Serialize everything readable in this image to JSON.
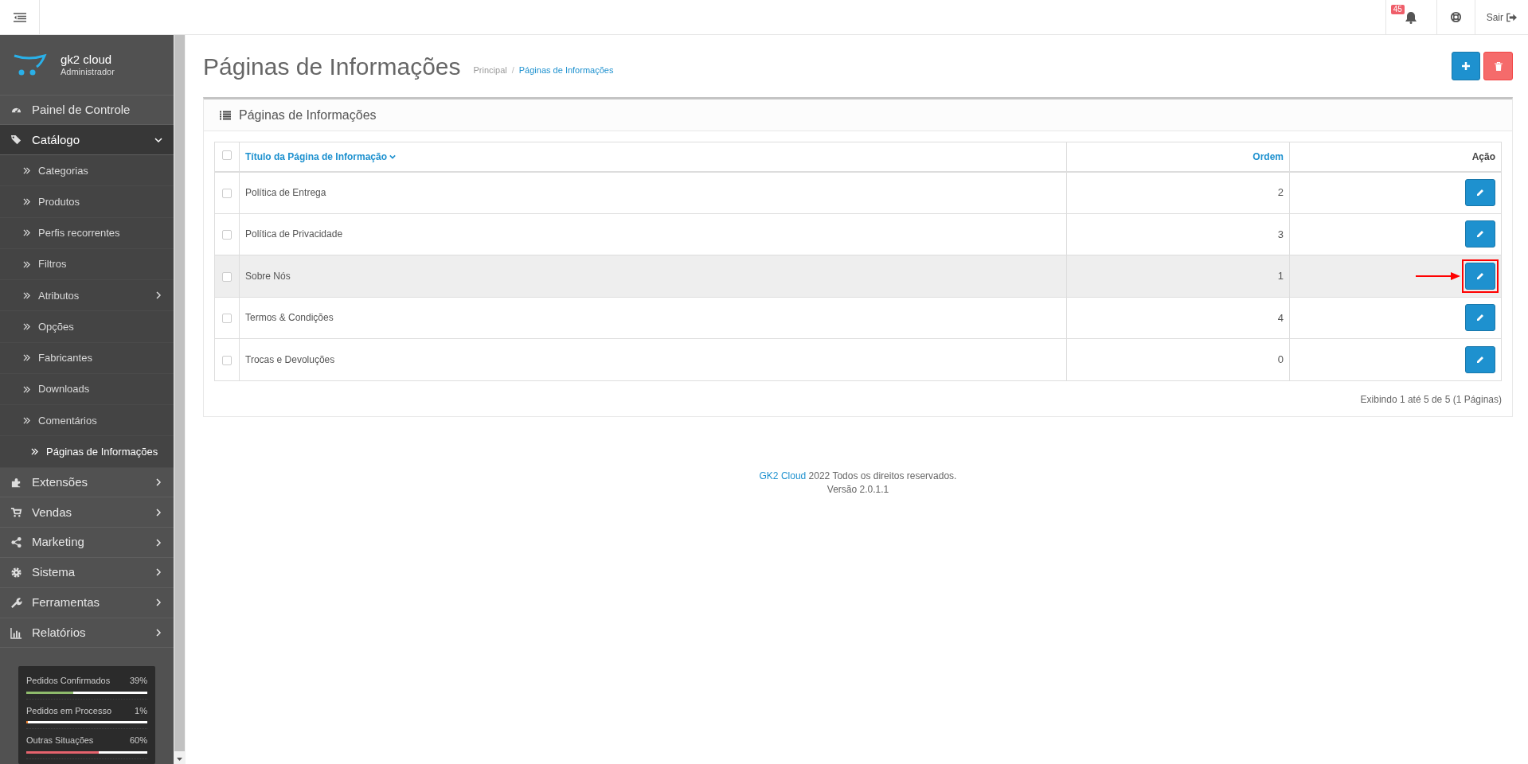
{
  "header": {
    "notifications": {
      "count": "45"
    },
    "logout": "Sair"
  },
  "sidebar": {
    "profile": {
      "name": "gk2 cloud",
      "role": "Administrador"
    },
    "items": [
      {
        "label": "Painel de Controle",
        "kind": "dashboard",
        "selected": false,
        "has_children": false,
        "expanded": false
      },
      {
        "label": "Catálogo",
        "kind": "tags",
        "selected": true,
        "has_children": true,
        "expanded": true,
        "children": [
          {
            "label": "Categorias",
            "selected": false,
            "has_children": false
          },
          {
            "label": "Produtos",
            "selected": false,
            "has_children": false
          },
          {
            "label": "Perfis recorrentes",
            "selected": false,
            "has_children": false
          },
          {
            "label": "Filtros",
            "selected": false,
            "has_children": false
          },
          {
            "label": "Atributos",
            "selected": false,
            "has_children": true
          },
          {
            "label": "Opções",
            "selected": false,
            "has_children": false
          },
          {
            "label": "Fabricantes",
            "selected": false,
            "has_children": false
          },
          {
            "label": "Downloads",
            "selected": false,
            "has_children": false
          },
          {
            "label": "Comentários",
            "selected": false,
            "has_children": false
          },
          {
            "label": "Páginas de Informações",
            "selected": true,
            "has_children": false
          }
        ]
      },
      {
        "label": "Extensões",
        "kind": "puzzle",
        "selected": false,
        "has_children": true,
        "expanded": false
      },
      {
        "label": "Vendas",
        "kind": "cart",
        "selected": false,
        "has_children": true,
        "expanded": false
      },
      {
        "label": "Marketing",
        "kind": "share",
        "selected": false,
        "has_children": true,
        "expanded": false
      },
      {
        "label": "Sistema",
        "kind": "gear",
        "selected": false,
        "has_children": true,
        "expanded": false
      },
      {
        "label": "Ferramentas",
        "kind": "wrench",
        "selected": false,
        "has_children": true,
        "expanded": false
      },
      {
        "label": "Relatórios",
        "kind": "chart",
        "selected": false,
        "has_children": true,
        "expanded": false
      }
    ],
    "stats": [
      {
        "label": "Pedidos Confirmados",
        "value": "39%",
        "level": 0.39,
        "color": "#8fbb6c"
      },
      {
        "label": "Pedidos em Processo",
        "value": "1%",
        "level": 0.01,
        "color": "#f38733"
      },
      {
        "label": "Outras Situações",
        "value": "60%",
        "level": 0.6,
        "color": "#e5636d"
      }
    ]
  },
  "page": {
    "title": "Páginas de Informações",
    "breadcrumb": [
      "Principal",
      "Páginas de Informações"
    ],
    "breadcrumb_separator": "/"
  },
  "panel": {
    "title": "Páginas de Informações",
    "table": {
      "all_checked": false,
      "columns": [
        "Título da Página de Informação",
        "Ordem",
        "Ação"
      ],
      "rows": [
        {
          "title": "Política de Entrega",
          "order": "2",
          "checked": false,
          "highlighted": false,
          "annotated": false
        },
        {
          "title": "Política de Privacidade",
          "order": "3",
          "checked": false,
          "highlighted": false,
          "annotated": false
        },
        {
          "title": "Sobre Nós",
          "order": "1",
          "checked": false,
          "highlighted": true,
          "annotated": true
        },
        {
          "title": "Termos & Condições",
          "order": "4",
          "checked": false,
          "highlighted": false,
          "annotated": false
        },
        {
          "title": "Trocas e Devoluções",
          "order": "0",
          "checked": false,
          "highlighted": false,
          "annotated": false
        }
      ]
    },
    "pagination": "Exibindo 1 até 5 de 5 (1 Páginas)"
  },
  "footer": {
    "brand": "GK2 Cloud",
    "text": "2022 Todos os direitos reservados.",
    "version": "Versão 2.0.1.1"
  }
}
